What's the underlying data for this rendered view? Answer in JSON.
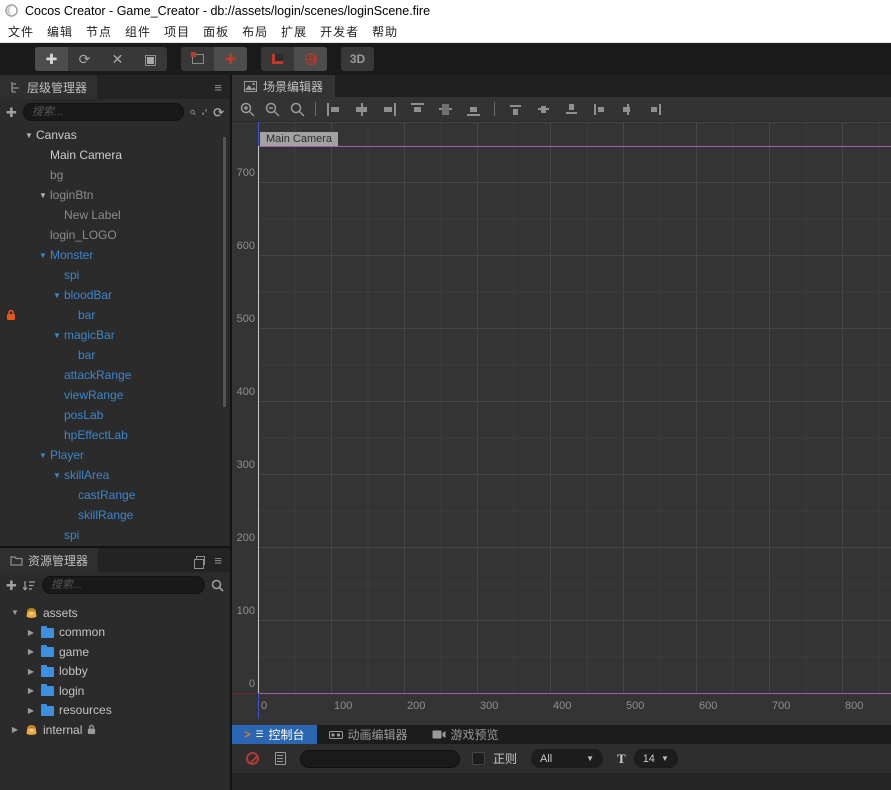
{
  "window": {
    "title": "Cocos Creator - Game_Creator - db://assets/login/scenes/loginScene.fire",
    "menus": [
      "文件",
      "编辑",
      "节点",
      "组件",
      "项目",
      "面板",
      "布局",
      "扩展",
      "开发者",
      "帮助"
    ]
  },
  "toolbar": {
    "tools": [
      "move-tool",
      "rotate-tool",
      "scale-tool",
      "rect-tool"
    ],
    "gizmo_buttons": [
      "position-mode",
      "anchor-mode"
    ],
    "view_buttons": [
      "border-gizmo",
      "grid-gizmo"
    ],
    "view3d_label": "3D"
  },
  "hierarchy": {
    "title": "层级管理器",
    "search_placeholder": "搜索...",
    "nodes": [
      {
        "label": "Canvas",
        "level": 0,
        "kind": "normal",
        "arrow": "down"
      },
      {
        "label": "Main Camera",
        "level": 1,
        "kind": "normal",
        "arrow": "none"
      },
      {
        "label": "bg",
        "level": 1,
        "kind": "dim",
        "arrow": "none"
      },
      {
        "label": "loginBtn",
        "level": 1,
        "kind": "dim",
        "arrow": "down"
      },
      {
        "label": "New Label",
        "level": 2,
        "kind": "dim",
        "arrow": "none"
      },
      {
        "label": "login_LOGO",
        "level": 1,
        "kind": "dim",
        "arrow": "none"
      },
      {
        "label": "Monster",
        "level": 1,
        "kind": "prefab",
        "arrow": "down"
      },
      {
        "label": "spi",
        "level": 2,
        "kind": "prefab",
        "arrow": "none"
      },
      {
        "label": "bloodBar",
        "level": 2,
        "kind": "prefab",
        "arrow": "down"
      },
      {
        "label": "bar",
        "level": 3,
        "kind": "prefab",
        "arrow": "none",
        "locked": true
      },
      {
        "label": "magicBar",
        "level": 2,
        "kind": "prefab",
        "arrow": "down"
      },
      {
        "label": "bar",
        "level": 3,
        "kind": "prefab",
        "arrow": "none"
      },
      {
        "label": "attackRange",
        "level": 2,
        "kind": "prefab",
        "arrow": "none"
      },
      {
        "label": "viewRange",
        "level": 2,
        "kind": "prefab",
        "arrow": "none"
      },
      {
        "label": "posLab",
        "level": 2,
        "kind": "prefab",
        "arrow": "none"
      },
      {
        "label": "hpEffectLab",
        "level": 2,
        "kind": "prefab",
        "arrow": "none"
      },
      {
        "label": "Player",
        "level": 1,
        "kind": "prefab",
        "arrow": "down"
      },
      {
        "label": "skillArea",
        "level": 2,
        "kind": "prefab",
        "arrow": "down"
      },
      {
        "label": "castRange",
        "level": 3,
        "kind": "prefab",
        "arrow": "none"
      },
      {
        "label": "skillRange",
        "level": 3,
        "kind": "prefab",
        "arrow": "none"
      },
      {
        "label": "spi",
        "level": 2,
        "kind": "prefab",
        "arrow": "none"
      }
    ]
  },
  "assets": {
    "title": "资源管理器",
    "search_placeholder": "搜索...",
    "nodes": [
      {
        "label": "assets",
        "level": 0,
        "icon": "db",
        "arrow": "down"
      },
      {
        "label": "common",
        "level": 1,
        "icon": "folder",
        "arrow": "right"
      },
      {
        "label": "game",
        "level": 1,
        "icon": "folder",
        "arrow": "right"
      },
      {
        "label": "lobby",
        "level": 1,
        "icon": "folder",
        "arrow": "right"
      },
      {
        "label": "login",
        "level": 1,
        "icon": "folder",
        "arrow": "right"
      },
      {
        "label": "resources",
        "level": 1,
        "icon": "folder",
        "arrow": "right"
      },
      {
        "label": "internal",
        "level": 0,
        "icon": "db",
        "arrow": "right",
        "locked": true
      }
    ]
  },
  "scene": {
    "tab_title": "场景编辑器",
    "camera_label": "Main Camera",
    "align_tools": [
      "align-left",
      "align-h-center",
      "align-right",
      "align-top",
      "align-v-middle",
      "align-bottom",
      "distribute-top",
      "distribute-v-center",
      "distribute-bottom",
      "distribute-left",
      "distribute-h-center",
      "distribute-right"
    ],
    "ruler": {
      "x_ticks": [
        0,
        100,
        200,
        300,
        400,
        500,
        600,
        700,
        800
      ],
      "y_ticks": [
        700,
        600,
        500,
        400,
        300,
        200,
        100,
        0
      ]
    }
  },
  "console": {
    "tabs": [
      "控制台",
      "动画编辑器",
      "游戏预览"
    ],
    "regex_label": "正则",
    "filter_value": "All",
    "font_size_value": "14"
  },
  "colors": {
    "accent_blue_tab": "#2b66b3",
    "prefab_blue": "#3c86cc",
    "canvas_border_purple": "#a85ba6",
    "lock_orange": "#e8541e",
    "folder_blue": "#3d8fe0",
    "db_orange": "#efa93f"
  }
}
